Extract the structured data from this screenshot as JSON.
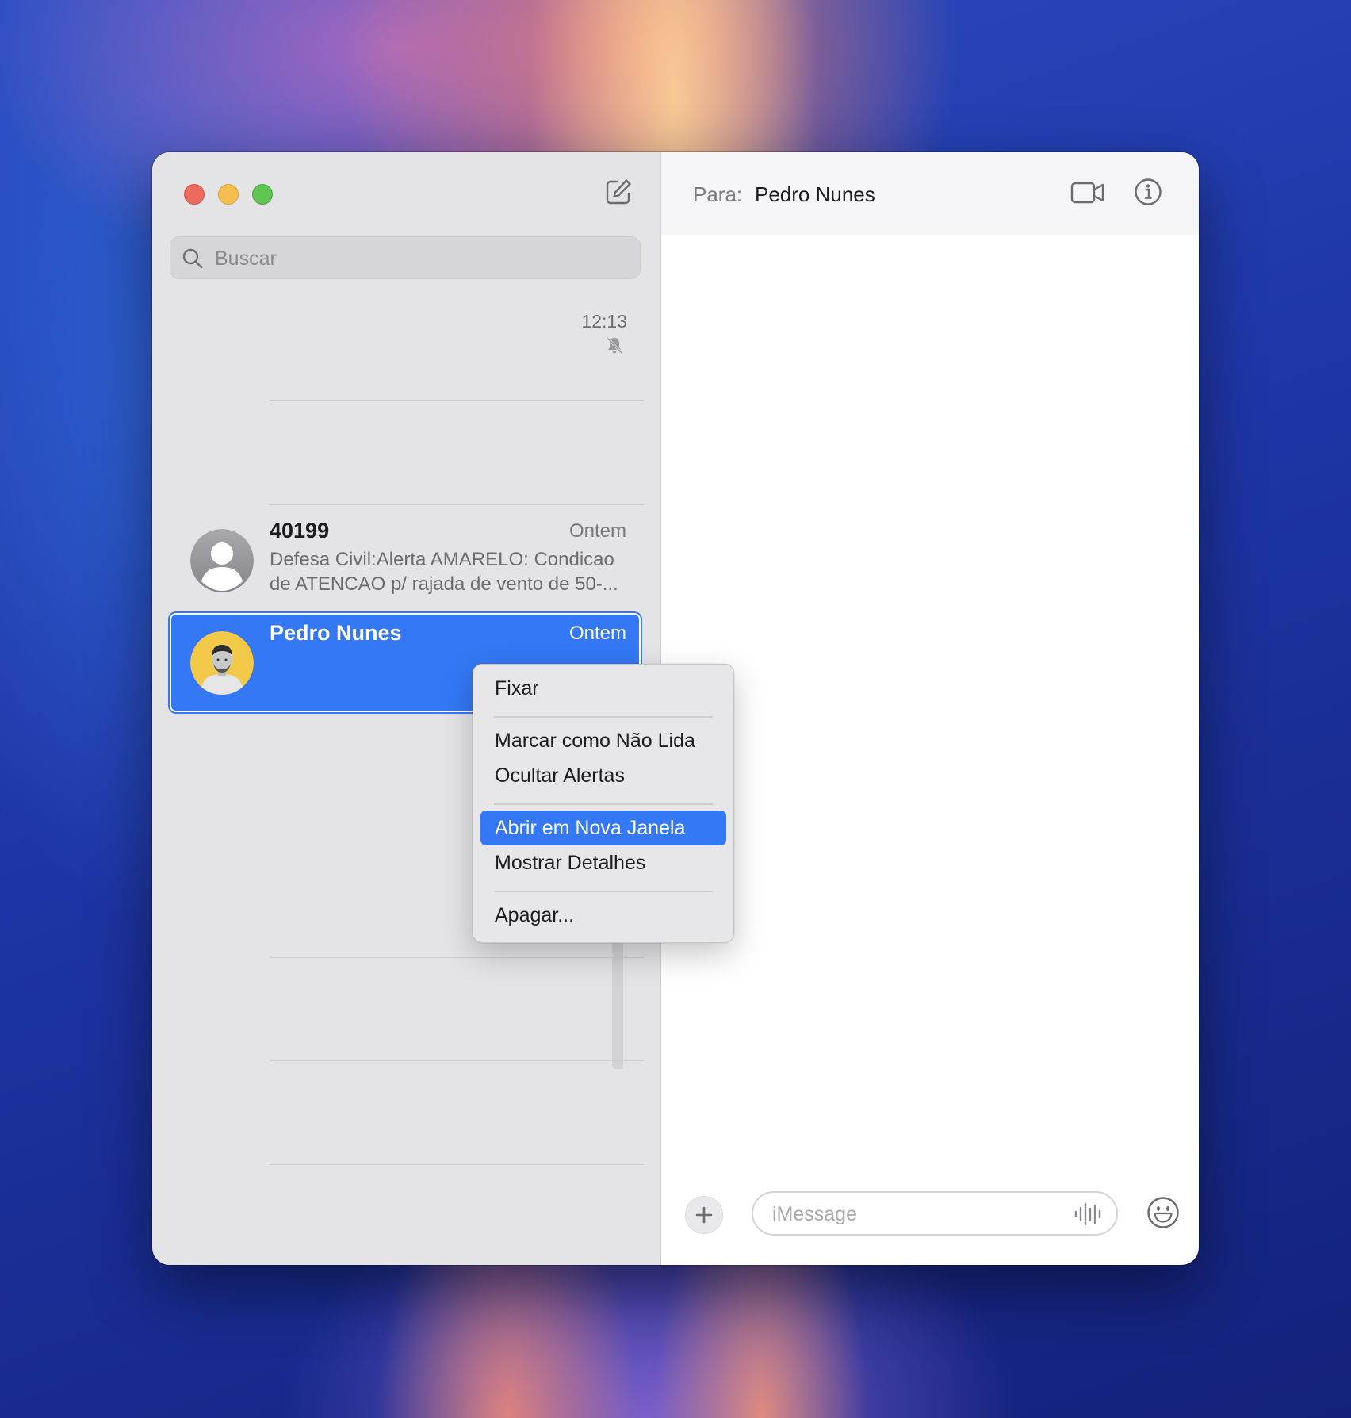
{
  "sidebar": {
    "search_placeholder": "Buscar",
    "top_item_time": "12:13",
    "conversations": [
      {
        "name": "40199",
        "date": "Ontem",
        "preview": "Defesa Civil:Alerta AMARELO: Condicao de ATENCAO p/ rajada de vento de 50-..."
      },
      {
        "name": "Pedro Nunes",
        "date": "Ontem",
        "selected": true
      }
    ]
  },
  "header": {
    "to_label": "Para:",
    "recipient": "Pedro Nunes"
  },
  "composer": {
    "placeholder": "iMessage"
  },
  "context_menu": {
    "items": [
      {
        "label": "Fixar"
      },
      {
        "label": "Marcar como Não Lida"
      },
      {
        "label": "Ocultar Alertas"
      },
      {
        "label": "Abrir em Nova Janela",
        "highlighted": true
      },
      {
        "label": "Mostrar Detalhes"
      },
      {
        "label": "Apagar..."
      }
    ]
  },
  "colors": {
    "accent": "#3478f5",
    "sidebar_bg": "#e4e4e7",
    "close": "#ec6a5e",
    "minimize": "#f4bf4f",
    "zoom": "#61c554"
  },
  "icons": [
    "compose-icon",
    "search-icon",
    "muted-bell-icon",
    "video-call-icon",
    "info-icon",
    "plus-icon",
    "audio-waveform-icon",
    "emoji-icon"
  ]
}
